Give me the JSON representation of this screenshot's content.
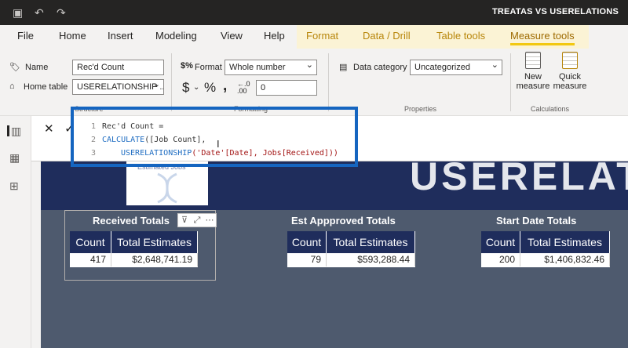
{
  "window": {
    "title": "TREATAS VS USERELATIONS"
  },
  "ribbon_tabs": [
    "File",
    "Home",
    "Insert",
    "Modeling",
    "View",
    "Help",
    "Format",
    "Data / Drill",
    "Table tools",
    "Measure tools"
  ],
  "structure": {
    "name_label": "Name",
    "name_value": "Rec'd Count",
    "home_table_label": "Home table",
    "home_table_value": "USERELATIONSHIP ...",
    "group_label": "Structure"
  },
  "formatting": {
    "format_label": "Format",
    "format_value": "Whole number",
    "dollar": "$",
    "percent": "%",
    "comma": ",",
    "decimals_value": "0",
    "group_label": "Formatting"
  },
  "properties": {
    "data_category_label": "Data category",
    "data_category_value": "Uncategorized",
    "group_label": "Properties"
  },
  "calculations": {
    "new_measure": [
      "New",
      "measure"
    ],
    "quick_measure": [
      "Quick",
      "measure"
    ],
    "group_label": "Calculations"
  },
  "formula_bar": {
    "line_numbers": [
      "1",
      "2",
      "3"
    ],
    "line1": "Rec'd Count =",
    "line2_fn": "CALCULATE",
    "line2_rest": "([Job Count],",
    "line3_fn": "USERELATIONSHIP",
    "line3_rest": "('Date'[Date], Jobs[Received]))",
    "behind_text": "Estimated Jobs"
  },
  "report": {
    "banner_text": "USERELATIONS",
    "visuals": [
      {
        "title": "Received Totals",
        "headers": [
          "Count",
          "Total Estimates"
        ],
        "row": [
          "417",
          "$2,648,741.19"
        ]
      },
      {
        "title": "Est Appproved Totals",
        "headers": [
          "Count",
          "Total Estimates"
        ],
        "row": [
          "79",
          "$593,288.44"
        ]
      },
      {
        "title": "Start Date Totals",
        "headers": [
          "Count",
          "Total Estimates"
        ],
        "row": [
          "200",
          "$1,406,832.46"
        ]
      }
    ]
  },
  "icons": [
    "save-icon",
    "undo-icon",
    "redo-icon",
    "report-view-icon",
    "data-view-icon",
    "model-view-icon",
    "filter-icon",
    "focus-mode-icon",
    "more-options-icon",
    "cancel-icon",
    "commit-icon"
  ]
}
